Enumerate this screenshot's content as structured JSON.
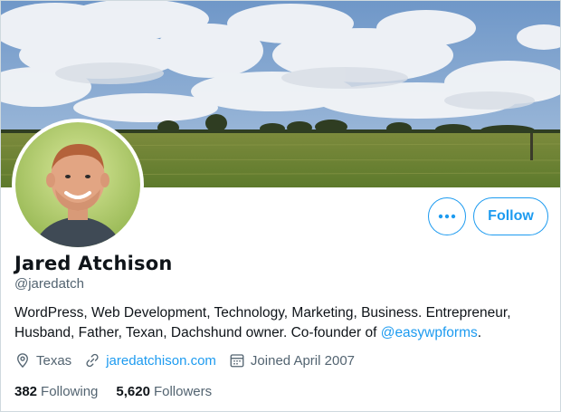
{
  "profile": {
    "name": "Jared Atchison",
    "handle": "@jaredatch",
    "bio_text": "WordPress, Web Development, Technology, Marketing, Business. Entrepreneur, Husband, Father, Texan, Dachshund owner. Co-founder of ",
    "bio_mention": "@easywpforms",
    "bio_end": ".",
    "location": "Texas",
    "website": "jaredatchison.com",
    "joined": "Joined April 2007",
    "following_count": "382",
    "following_label": "Following",
    "followers_count": "5,620",
    "followers_label": "Followers"
  },
  "actions": {
    "follow_label": "Follow",
    "more_icon": "more-horizontal-icon"
  },
  "icons": {
    "location": "location-pin-icon",
    "link": "link-icon",
    "calendar": "calendar-icon"
  },
  "colors": {
    "accent": "#1d9bf0",
    "muted": "#536471",
    "text": "#0f1419"
  }
}
